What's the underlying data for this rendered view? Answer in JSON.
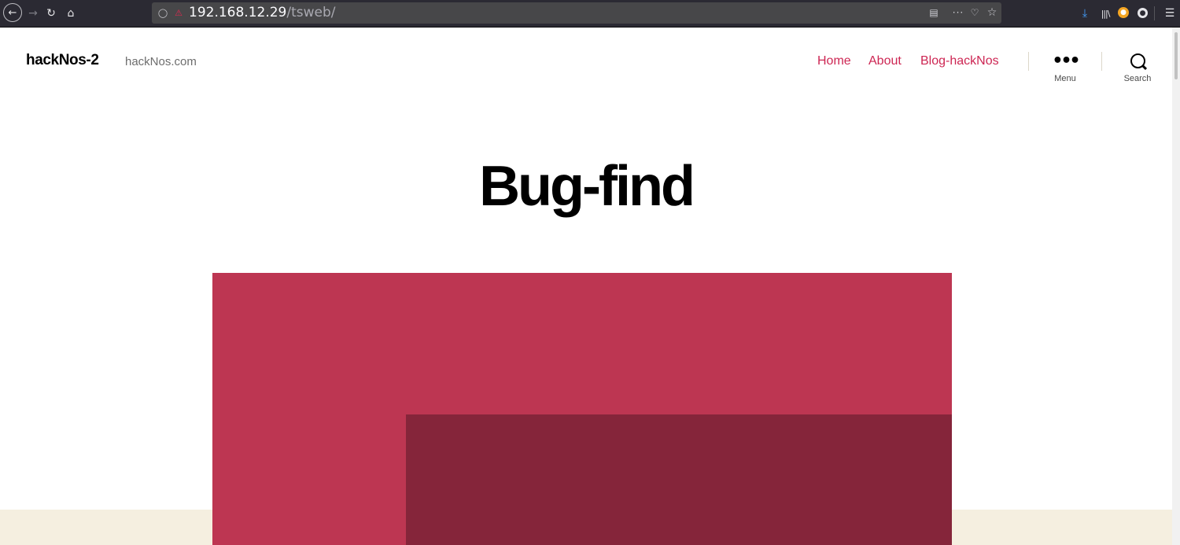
{
  "browser": {
    "url_host": "192.168.12.29",
    "url_path": "/tsweb/",
    "icons": {
      "back": "arrow-left-icon",
      "forward": "arrow-right-icon",
      "reload": "reload-icon",
      "home": "home-icon",
      "shield": "shield-icon",
      "insecure_lock": "insecure-lock-icon",
      "reader": "reader-view-icon",
      "more": "more-icon",
      "pocket": "pocket-icon",
      "bookmark": "star-icon",
      "download": "download-icon",
      "library": "library-icon",
      "extension": "extension-icon",
      "account": "account-icon",
      "menu": "hamburger-menu-icon"
    }
  },
  "site": {
    "title": "hackNos-2",
    "description": "hackNos.com"
  },
  "nav": {
    "items": [
      {
        "label": "Home"
      },
      {
        "label": "About"
      },
      {
        "label": "Blog-hackNos"
      }
    ]
  },
  "toggles": {
    "menu_label": "Menu",
    "search_label": "Search"
  },
  "post": {
    "title": "Bug-find"
  },
  "colors": {
    "accent": "#cd2653",
    "featured_primary": "#bd3652",
    "featured_dark": "#85253a",
    "band_beige": "#f5efe0"
  }
}
